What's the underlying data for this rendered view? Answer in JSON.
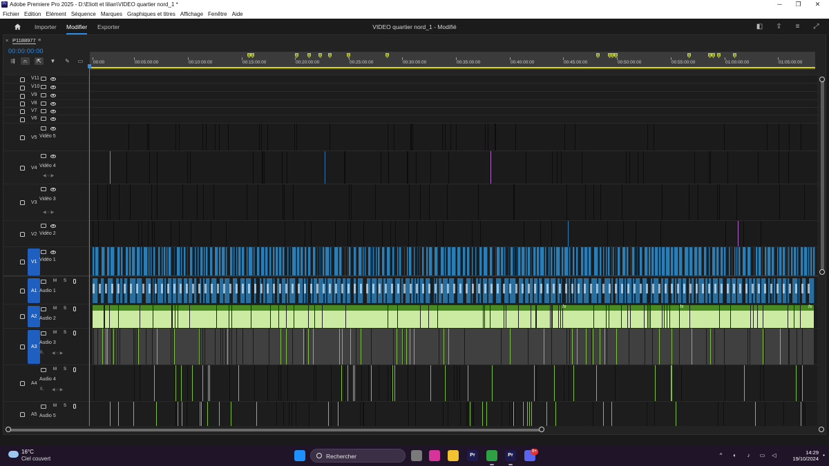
{
  "window": {
    "title": "Adobe Premiere Pro 2025 - D:\\Eliott et lilian\\VIDEO quartier nord_1 *",
    "app_icon_text": "Pr",
    "controls": [
      "─",
      "❐",
      "✕"
    ]
  },
  "menu": [
    "Fichier",
    "Edition",
    "Elément",
    "Séquence",
    "Marques",
    "Graphiques et titres",
    "Affichage",
    "Fenêtre",
    "Aide"
  ],
  "header": {
    "workspaces": [
      "Importer",
      "Modifier",
      "Exporter"
    ],
    "active_workspace": "Modifier",
    "sequence_title": "VIDEO quartier nord_1 - Modifié"
  },
  "timeline": {
    "sequence_name": "P1188977",
    "timecode": "00:00:00:00",
    "ruler_ticks": [
      "00:00",
      "00:05:00:00",
      "00:10:00:00",
      "00:15:00:00",
      "00:20:00:00",
      "00:25:00:00",
      "00:30:00:00",
      "00:35:00:00",
      "00:40:00:00",
      "00:45:00:00",
      "00:50:00:00",
      "00:55:00:00",
      "01:00:00:00",
      "01:05:00:00"
    ],
    "video_tracks": [
      {
        "id": "V11",
        "label": ""
      },
      {
        "id": "V10",
        "label": ""
      },
      {
        "id": "V9",
        "label": ""
      },
      {
        "id": "V8",
        "label": ""
      },
      {
        "id": "V7",
        "label": ""
      },
      {
        "id": "V6",
        "label": ""
      },
      {
        "id": "V5",
        "label": "Vidéo 5"
      },
      {
        "id": "V4",
        "label": "Vidéo 4"
      },
      {
        "id": "V3",
        "label": "Vidéo 3"
      },
      {
        "id": "V2",
        "label": "Vidéo 2"
      },
      {
        "id": "V1",
        "label": "Vidéo 1"
      }
    ],
    "audio_tracks": [
      {
        "id": "A1",
        "label": "Audio 1",
        "m": "M",
        "s": "S"
      },
      {
        "id": "A2",
        "label": "Audio 2",
        "m": "M",
        "s": "S"
      },
      {
        "id": "A3",
        "label": "Audio 3",
        "m": "M",
        "s": "S",
        "extra": "0,"
      },
      {
        "id": "A4",
        "label": "Audio 4",
        "m": "M",
        "s": "S",
        "extra": "0,"
      },
      {
        "id": "A5",
        "label": "Audio 5",
        "m": "M",
        "s": "S"
      }
    ],
    "fx_label": "fx"
  },
  "colors": {
    "accent": "#2d8ceb",
    "video_clip": "#2a7db5",
    "audio1_clip": "#2a6e9e",
    "audio2_clip": "#cbeaa2",
    "audio3_clip": "#404040",
    "marker": "#8b962f",
    "track_badge": "#1f5fbf"
  },
  "taskbar": {
    "weather_temp": "16°C",
    "weather_desc": "Ciel couvert",
    "search_placeholder": "Rechercher",
    "time": "14:29",
    "date": "19/10/2024",
    "apps": [
      {
        "name": "windows-start",
        "text": "",
        "color": "#1e90ff"
      },
      {
        "name": "task-view",
        "text": "",
        "color": "#7a7a7a"
      },
      {
        "name": "instagram",
        "text": "",
        "color": "#d6349b"
      },
      {
        "name": "file-explorer",
        "text": "",
        "color": "#f2c230"
      },
      {
        "name": "premiere-pinned",
        "text": "Pr",
        "color": "#1d1b4d"
      },
      {
        "name": "chrome",
        "text": "",
        "color": "#2ea043"
      },
      {
        "name": "premiere-active",
        "text": "Pr",
        "color": "#1d1b4d"
      },
      {
        "name": "discord",
        "text": "",
        "color": "#5865f2"
      }
    ],
    "discord_badge": "9+"
  }
}
